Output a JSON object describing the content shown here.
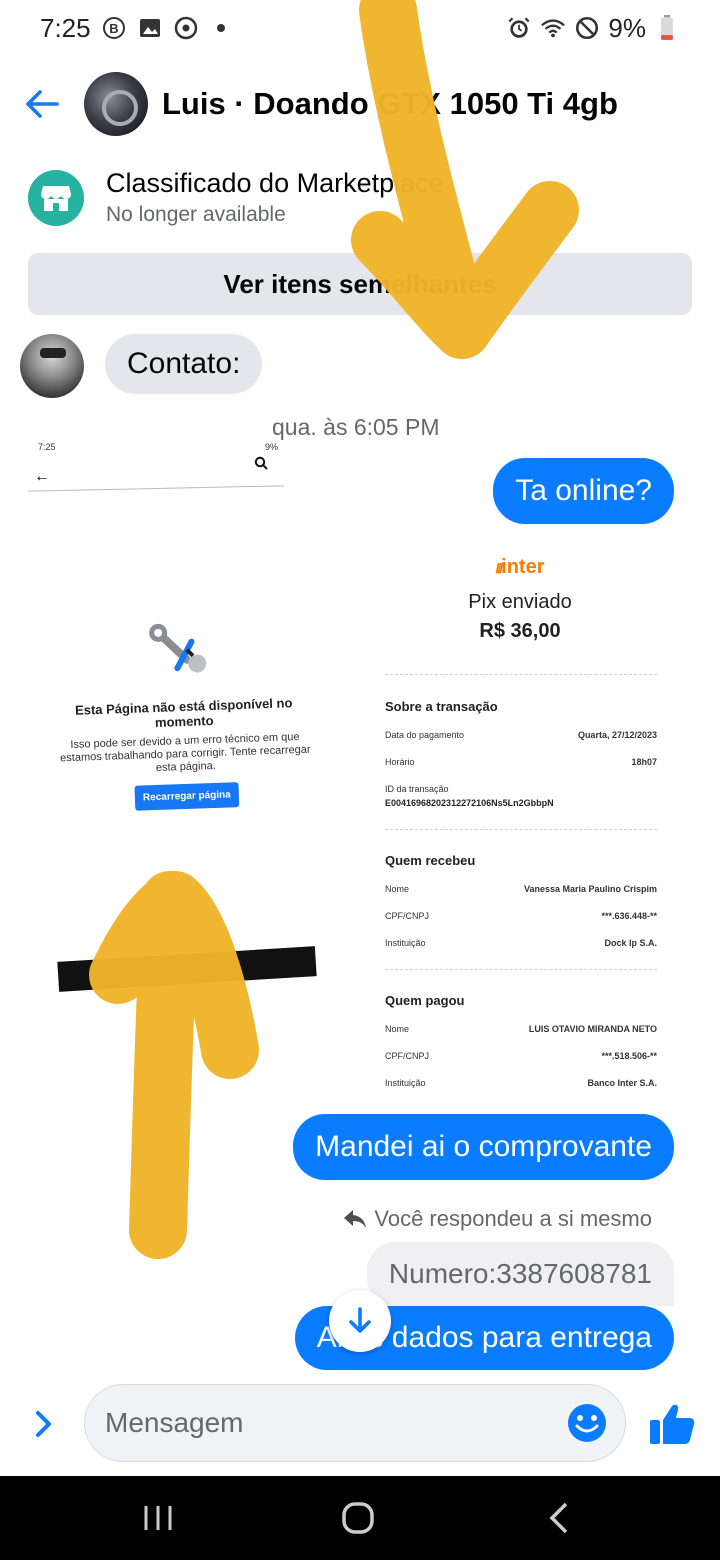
{
  "status_bar": {
    "time": "7:25",
    "battery": "9%"
  },
  "header": {
    "title": "Luis · Doando GTX 1050 Ti 4gb"
  },
  "listing": {
    "title": "Classificado do Marketplace",
    "subtitle": "No longer available",
    "button_label": "Ver itens semelhantes"
  },
  "messages": {
    "contact_message": "Contato:",
    "timestamp": "qua. às 6:05 PM",
    "out_1": "Ta online?",
    "out_2": "Mandei ai o comprovante",
    "reply_note": "Você respondeu a si mesmo",
    "reply_quote": "Numero:3387608781",
    "out_3": "Ai os dados para entrega"
  },
  "embedded_screenshot": {
    "time": "7:25",
    "battery": "9%",
    "title": "Esta Página não está disponível no momento",
    "description": "Isso pode ser devido a um erro técnico em que estamos trabalhando para corrigir. Tente recarregar esta página.",
    "button": "Recarregar página"
  },
  "receipt": {
    "brand": "inter",
    "title": "Pix enviado",
    "amount": "R$ 36,00",
    "about_section": "Sobre a transação",
    "payment_date_label": "Data do pagamento",
    "payment_date": "Quarta, 27/12/2023",
    "time_label": "Horário",
    "time": "18h07",
    "transaction_id_label": "ID da transação",
    "transaction_id": "E00416968202312272106Ns5Ln2GbbpN",
    "receiver_section": "Quem recebeu",
    "receiver_name_label": "Nome",
    "receiver_name": "Vanessa Maria Paulino Crispim",
    "receiver_doc_label": "CPF/CNPJ",
    "receiver_doc": "***.636.448-**",
    "receiver_inst_label": "Instituição",
    "receiver_inst": "Dock Ip S.A.",
    "payer_section": "Quem pagou",
    "payer_name_label": "Nome",
    "payer_name": "LUIS OTAVIO MIRANDA NETO",
    "payer_doc_label": "CPF/CNPJ",
    "payer_doc": "***.518.506-**",
    "payer_inst_label": "Instituição",
    "payer_inst": "Banco Inter S.A."
  },
  "composer": {
    "placeholder": "Mensagem"
  },
  "colors": {
    "accent": "#0a7cff",
    "bubble_in": "#e4e6eb",
    "annotation": "#f0b429",
    "marketplace": "#27b1a0"
  }
}
